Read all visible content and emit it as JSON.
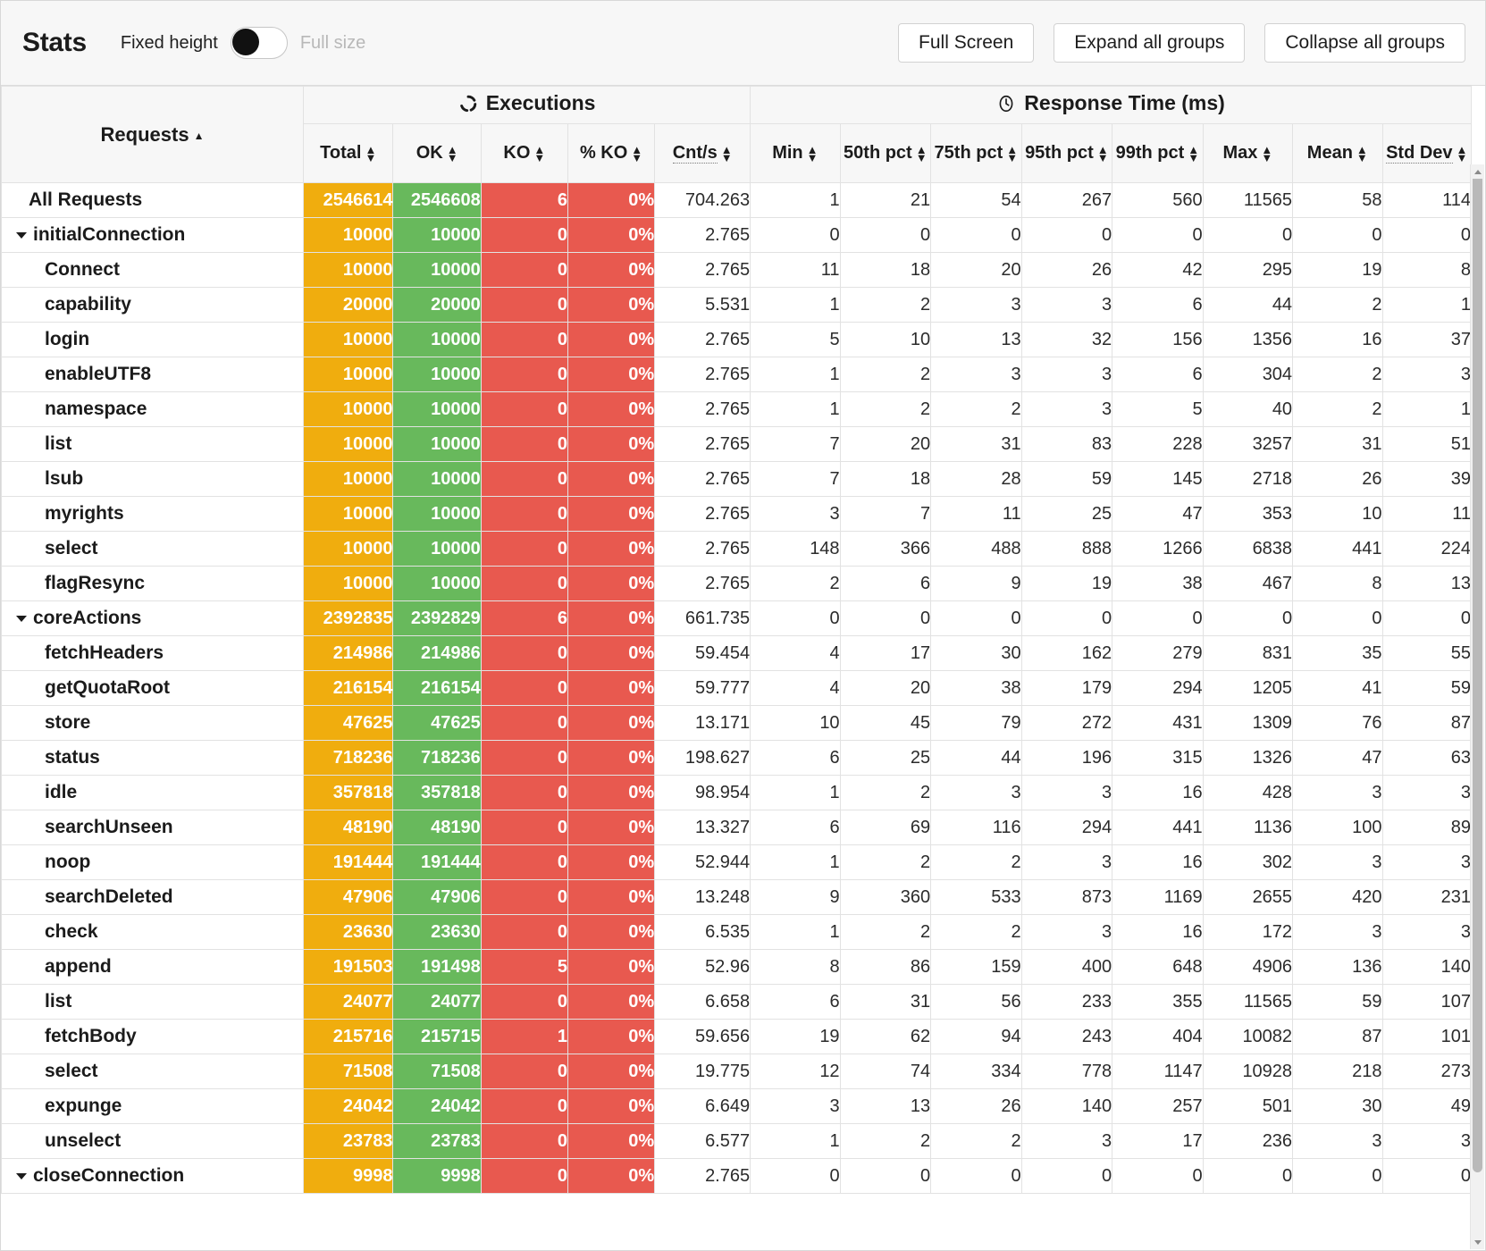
{
  "toolbar": {
    "title": "Stats",
    "toggle_on_label": "Fixed height",
    "toggle_off_label": "Full size",
    "full_screen_label": "Full Screen",
    "expand_all_label": "Expand all groups",
    "collapse_all_label": "Collapse all groups"
  },
  "header": {
    "requests_label": "Requests",
    "requests_sort": "▲",
    "group_executions": "Executions",
    "group_response_time": "Response Time (ms)",
    "executions_icon": "refresh-icon",
    "response_time_icon": "clock-icon",
    "columns": [
      "Total",
      "OK",
      "KO",
      "% KO",
      "Cnt/s",
      "Min",
      "50th pct",
      "75th pct",
      "95th pct",
      "99th pct",
      "Max",
      "Mean",
      "Std Dev"
    ]
  },
  "colors": {
    "total": "#f0ad0e",
    "ok": "#68b95c",
    "ko": "#e8594f",
    "header_bg": "#f7f7f7"
  },
  "chart_data": {
    "type": "table",
    "title": "Stats",
    "columns": [
      "Requests",
      "Total",
      "OK",
      "KO",
      "% KO",
      "Cnt/s",
      "Min",
      "50th pct",
      "75th pct",
      "95th pct",
      "99th pct",
      "Max",
      "Mean",
      "Std Dev"
    ],
    "rows": [
      {
        "name": "All Requests",
        "level": 0,
        "group": false,
        "total": "2546614",
        "ok": "2546608",
        "ko": "6",
        "pko": "0%",
        "cnts": "704.263",
        "min": "1",
        "p50": "21",
        "p75": "54",
        "p95": "267",
        "p99": "560",
        "max": "11565",
        "mean": "58",
        "std": "114"
      },
      {
        "name": "initialConnection",
        "level": 1,
        "group": true,
        "total": "10000",
        "ok": "10000",
        "ko": "0",
        "pko": "0%",
        "cnts": "2.765",
        "min": "0",
        "p50": "0",
        "p75": "0",
        "p95": "0",
        "p99": "0",
        "max": "0",
        "mean": "0",
        "std": "0"
      },
      {
        "name": "Connect",
        "level": 2,
        "group": false,
        "total": "10000",
        "ok": "10000",
        "ko": "0",
        "pko": "0%",
        "cnts": "2.765",
        "min": "11",
        "p50": "18",
        "p75": "20",
        "p95": "26",
        "p99": "42",
        "max": "295",
        "mean": "19",
        "std": "8"
      },
      {
        "name": "capability",
        "level": 2,
        "group": false,
        "total": "20000",
        "ok": "20000",
        "ko": "0",
        "pko": "0%",
        "cnts": "5.531",
        "min": "1",
        "p50": "2",
        "p75": "3",
        "p95": "3",
        "p99": "6",
        "max": "44",
        "mean": "2",
        "std": "1"
      },
      {
        "name": "login",
        "level": 2,
        "group": false,
        "total": "10000",
        "ok": "10000",
        "ko": "0",
        "pko": "0%",
        "cnts": "2.765",
        "min": "5",
        "p50": "10",
        "p75": "13",
        "p95": "32",
        "p99": "156",
        "max": "1356",
        "mean": "16",
        "std": "37"
      },
      {
        "name": "enableUTF8",
        "level": 2,
        "group": false,
        "total": "10000",
        "ok": "10000",
        "ko": "0",
        "pko": "0%",
        "cnts": "2.765",
        "min": "1",
        "p50": "2",
        "p75": "3",
        "p95": "3",
        "p99": "6",
        "max": "304",
        "mean": "2",
        "std": "3"
      },
      {
        "name": "namespace",
        "level": 2,
        "group": false,
        "total": "10000",
        "ok": "10000",
        "ko": "0",
        "pko": "0%",
        "cnts": "2.765",
        "min": "1",
        "p50": "2",
        "p75": "2",
        "p95": "3",
        "p99": "5",
        "max": "40",
        "mean": "2",
        "std": "1"
      },
      {
        "name": "list",
        "level": 2,
        "group": false,
        "total": "10000",
        "ok": "10000",
        "ko": "0",
        "pko": "0%",
        "cnts": "2.765",
        "min": "7",
        "p50": "20",
        "p75": "31",
        "p95": "83",
        "p99": "228",
        "max": "3257",
        "mean": "31",
        "std": "51"
      },
      {
        "name": "lsub",
        "level": 2,
        "group": false,
        "total": "10000",
        "ok": "10000",
        "ko": "0",
        "pko": "0%",
        "cnts": "2.765",
        "min": "7",
        "p50": "18",
        "p75": "28",
        "p95": "59",
        "p99": "145",
        "max": "2718",
        "mean": "26",
        "std": "39"
      },
      {
        "name": "myrights",
        "level": 2,
        "group": false,
        "total": "10000",
        "ok": "10000",
        "ko": "0",
        "pko": "0%",
        "cnts": "2.765",
        "min": "3",
        "p50": "7",
        "p75": "11",
        "p95": "25",
        "p99": "47",
        "max": "353",
        "mean": "10",
        "std": "11"
      },
      {
        "name": "select",
        "level": 2,
        "group": false,
        "total": "10000",
        "ok": "10000",
        "ko": "0",
        "pko": "0%",
        "cnts": "2.765",
        "min": "148",
        "p50": "366",
        "p75": "488",
        "p95": "888",
        "p99": "1266",
        "max": "6838",
        "mean": "441",
        "std": "224"
      },
      {
        "name": "flagResync",
        "level": 2,
        "group": false,
        "total": "10000",
        "ok": "10000",
        "ko": "0",
        "pko": "0%",
        "cnts": "2.765",
        "min": "2",
        "p50": "6",
        "p75": "9",
        "p95": "19",
        "p99": "38",
        "max": "467",
        "mean": "8",
        "std": "13"
      },
      {
        "name": "coreActions",
        "level": 1,
        "group": true,
        "total": "2392835",
        "ok": "2392829",
        "ko": "6",
        "pko": "0%",
        "cnts": "661.735",
        "min": "0",
        "p50": "0",
        "p75": "0",
        "p95": "0",
        "p99": "0",
        "max": "0",
        "mean": "0",
        "std": "0"
      },
      {
        "name": "fetchHeaders",
        "level": 2,
        "group": false,
        "total": "214986",
        "ok": "214986",
        "ko": "0",
        "pko": "0%",
        "cnts": "59.454",
        "min": "4",
        "p50": "17",
        "p75": "30",
        "p95": "162",
        "p99": "279",
        "max": "831",
        "mean": "35",
        "std": "55"
      },
      {
        "name": "getQuotaRoot",
        "level": 2,
        "group": false,
        "total": "216154",
        "ok": "216154",
        "ko": "0",
        "pko": "0%",
        "cnts": "59.777",
        "min": "4",
        "p50": "20",
        "p75": "38",
        "p95": "179",
        "p99": "294",
        "max": "1205",
        "mean": "41",
        "std": "59"
      },
      {
        "name": "store",
        "level": 2,
        "group": false,
        "total": "47625",
        "ok": "47625",
        "ko": "0",
        "pko": "0%",
        "cnts": "13.171",
        "min": "10",
        "p50": "45",
        "p75": "79",
        "p95": "272",
        "p99": "431",
        "max": "1309",
        "mean": "76",
        "std": "87"
      },
      {
        "name": "status",
        "level": 2,
        "group": false,
        "total": "718236",
        "ok": "718236",
        "ko": "0",
        "pko": "0%",
        "cnts": "198.627",
        "min": "6",
        "p50": "25",
        "p75": "44",
        "p95": "196",
        "p99": "315",
        "max": "1326",
        "mean": "47",
        "std": "63"
      },
      {
        "name": "idle",
        "level": 2,
        "group": false,
        "total": "357818",
        "ok": "357818",
        "ko": "0",
        "pko": "0%",
        "cnts": "98.954",
        "min": "1",
        "p50": "2",
        "p75": "3",
        "p95": "3",
        "p99": "16",
        "max": "428",
        "mean": "3",
        "std": "3"
      },
      {
        "name": "searchUnseen",
        "level": 2,
        "group": false,
        "total": "48190",
        "ok": "48190",
        "ko": "0",
        "pko": "0%",
        "cnts": "13.327",
        "min": "6",
        "p50": "69",
        "p75": "116",
        "p95": "294",
        "p99": "441",
        "max": "1136",
        "mean": "100",
        "std": "89"
      },
      {
        "name": "noop",
        "level": 2,
        "group": false,
        "total": "191444",
        "ok": "191444",
        "ko": "0",
        "pko": "0%",
        "cnts": "52.944",
        "min": "1",
        "p50": "2",
        "p75": "2",
        "p95": "3",
        "p99": "16",
        "max": "302",
        "mean": "3",
        "std": "3"
      },
      {
        "name": "searchDeleted",
        "level": 2,
        "group": false,
        "total": "47906",
        "ok": "47906",
        "ko": "0",
        "pko": "0%",
        "cnts": "13.248",
        "min": "9",
        "p50": "360",
        "p75": "533",
        "p95": "873",
        "p99": "1169",
        "max": "2655",
        "mean": "420",
        "std": "231"
      },
      {
        "name": "check",
        "level": 2,
        "group": false,
        "total": "23630",
        "ok": "23630",
        "ko": "0",
        "pko": "0%",
        "cnts": "6.535",
        "min": "1",
        "p50": "2",
        "p75": "2",
        "p95": "3",
        "p99": "16",
        "max": "172",
        "mean": "3",
        "std": "3"
      },
      {
        "name": "append",
        "level": 2,
        "group": false,
        "total": "191503",
        "ok": "191498",
        "ko": "5",
        "pko": "0%",
        "cnts": "52.96",
        "min": "8",
        "p50": "86",
        "p75": "159",
        "p95": "400",
        "p99": "648",
        "max": "4906",
        "mean": "136",
        "std": "140"
      },
      {
        "name": "list",
        "level": 2,
        "group": false,
        "total": "24077",
        "ok": "24077",
        "ko": "0",
        "pko": "0%",
        "cnts": "6.658",
        "min": "6",
        "p50": "31",
        "p75": "56",
        "p95": "233",
        "p99": "355",
        "max": "11565",
        "mean": "59",
        "std": "107"
      },
      {
        "name": "fetchBody",
        "level": 2,
        "group": false,
        "total": "215716",
        "ok": "215715",
        "ko": "1",
        "pko": "0%",
        "cnts": "59.656",
        "min": "19",
        "p50": "62",
        "p75": "94",
        "p95": "243",
        "p99": "404",
        "max": "10082",
        "mean": "87",
        "std": "101"
      },
      {
        "name": "select",
        "level": 2,
        "group": false,
        "total": "71508",
        "ok": "71508",
        "ko": "0",
        "pko": "0%",
        "cnts": "19.775",
        "min": "12",
        "p50": "74",
        "p75": "334",
        "p95": "778",
        "p99": "1147",
        "max": "10928",
        "mean": "218",
        "std": "273"
      },
      {
        "name": "expunge",
        "level": 2,
        "group": false,
        "total": "24042",
        "ok": "24042",
        "ko": "0",
        "pko": "0%",
        "cnts": "6.649",
        "min": "3",
        "p50": "13",
        "p75": "26",
        "p95": "140",
        "p99": "257",
        "max": "501",
        "mean": "30",
        "std": "49"
      },
      {
        "name": "unselect",
        "level": 2,
        "group": false,
        "total": "23783",
        "ok": "23783",
        "ko": "0",
        "pko": "0%",
        "cnts": "6.577",
        "min": "1",
        "p50": "2",
        "p75": "2",
        "p95": "3",
        "p99": "17",
        "max": "236",
        "mean": "3",
        "std": "3"
      },
      {
        "name": "closeConnection",
        "level": 1,
        "group": true,
        "total": "9998",
        "ok": "9998",
        "ko": "0",
        "pko": "0%",
        "cnts": "2.765",
        "min": "0",
        "p50": "0",
        "p75": "0",
        "p95": "0",
        "p99": "0",
        "max": "0",
        "mean": "0",
        "std": "0"
      }
    ]
  }
}
